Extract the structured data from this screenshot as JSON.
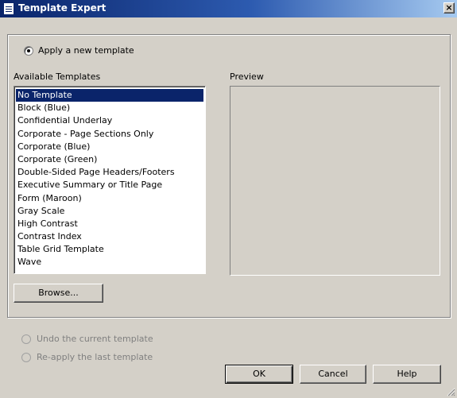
{
  "window": {
    "title": "Template Expert",
    "icon": "document-icon",
    "close_glyph": "×"
  },
  "apply_option": {
    "label": "Apply a new template",
    "checked": true
  },
  "templates": {
    "label": "Available Templates",
    "items": [
      "No Template",
      "Block (Blue)",
      "Confidential Underlay",
      "Corporate - Page Sections Only",
      "Corporate (Blue)",
      "Corporate (Green)",
      "Double-Sided Page Headers/Footers",
      "Executive Summary or Title Page",
      "Form (Maroon)",
      "Gray Scale",
      "High Contrast",
      "Contrast Index",
      "Table Grid Template",
      "Wave"
    ],
    "selected": "No Template"
  },
  "preview": {
    "label": "Preview"
  },
  "browse_button": "Browse...",
  "undo_option": {
    "label": "Undo the current template",
    "enabled": false
  },
  "reapply_option": {
    "label": "Re-apply the last template",
    "enabled": false
  },
  "footer": {
    "ok": "OK",
    "cancel": "Cancel",
    "help": "Help"
  },
  "colors": {
    "title_bar": "#0a246a",
    "selection": "#0a246a",
    "face": "#d4d0c8"
  }
}
